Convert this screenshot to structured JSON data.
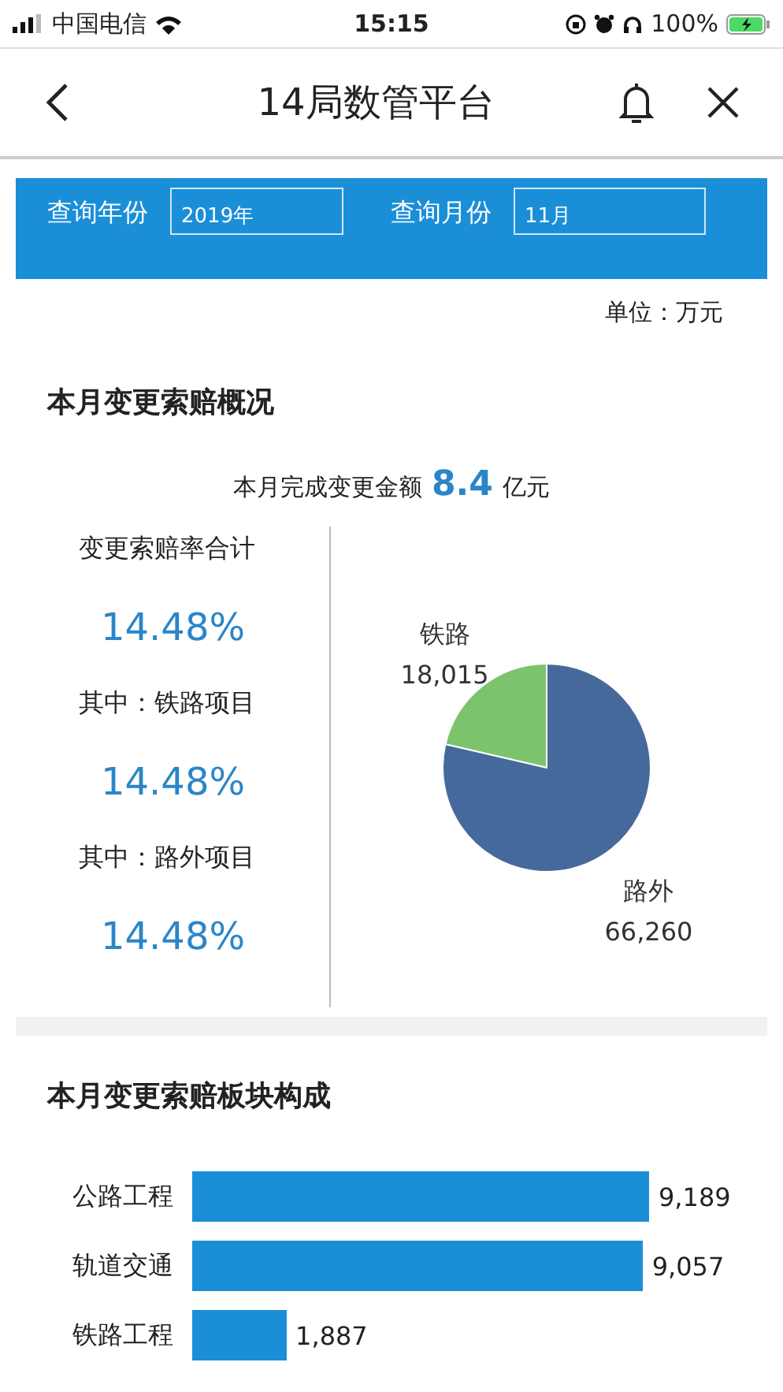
{
  "status_bar": {
    "carrier": "中国电信",
    "time": "15:15",
    "battery": "100%"
  },
  "nav": {
    "title": "14局数管平台"
  },
  "filters": [
    {
      "label": "查询年份",
      "value": "2019年"
    },
    {
      "label": "查询月份",
      "value": "11月"
    }
  ],
  "unit": "单位：万元",
  "overview": {
    "title": "本月变更索赔概况",
    "summary_label": "本月完成变更金额",
    "summary_value": "8.4",
    "summary_unit": "亿元",
    "stats": [
      {
        "label": "变更索赔率合计",
        "value": "14.48%"
      },
      {
        "label": "其中：铁路项目",
        "value": "14.48%"
      },
      {
        "label": "其中：路外项目",
        "value": "14.48%"
      }
    ],
    "chart_data": {
      "type": "pie",
      "categories": [
        "铁路",
        "路外"
      ],
      "values": [
        18015,
        66260
      ],
      "value_labels": [
        "18,015",
        "66,260"
      ]
    }
  },
  "sectors": {
    "title": "本月变更索赔板块构成",
    "chart_data": {
      "type": "bar",
      "orientation": "horizontal",
      "categories": [
        "公路工程",
        "轨道交通",
        "铁路工程"
      ],
      "values": [
        9189,
        9057,
        1887
      ],
      "value_labels": [
        "9,189",
        "9,057",
        "1,887"
      ]
    }
  }
}
